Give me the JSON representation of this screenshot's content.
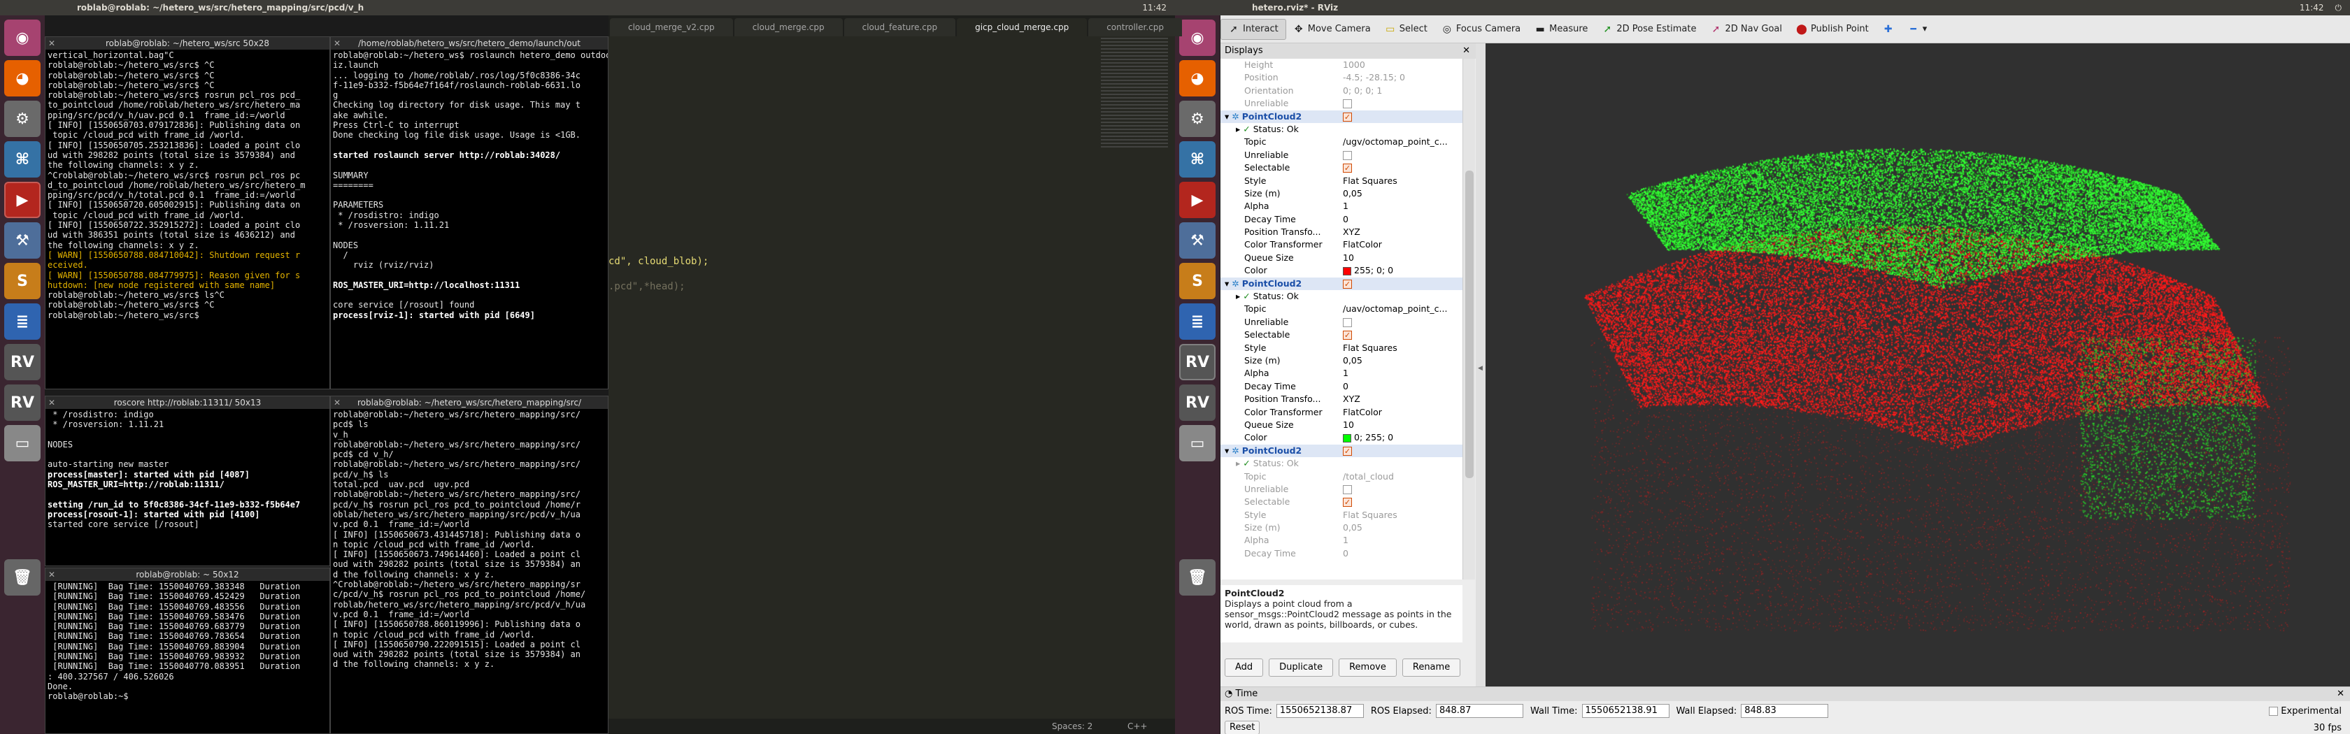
{
  "topbar_left": {
    "title": "roblab@roblab: ~/hetero_ws/src/hetero_mapping/src/pcd/v_h",
    "time": "11:42"
  },
  "topbar_right": {
    "title": "hetero.rviz* - RViz",
    "time": "11:42"
  },
  "launcher": {
    "items": [
      "dash-icon",
      "firefox-icon",
      "settings-icon",
      "python-icon",
      "terminal-icon",
      "system-settings-icon",
      "sublime-icon",
      "document-icon",
      "rviz-icon",
      "rviz-icon",
      "drive-icon",
      "trash-icon"
    ]
  },
  "terminals": {
    "t1": {
      "title": "roblab@roblab: ~/hetero_ws/src 50x28",
      "lines": [
        "vertical_horizontal.bag\"C",
        "roblab@roblab:~/hetero_ws/src$ ^C",
        "roblab@roblab:~/hetero_ws/src$ ^C",
        "roblab@roblab:~/hetero_ws/src$ ^C",
        "roblab@roblab:~/hetero_ws/src$ rosrun pcl_ros pcd_",
        "to_pointcloud /home/roblab/hetero_ws/src/hetero_ma",
        "pping/src/pcd/v_h/uav.pcd 0.1  frame_id:=/world",
        "[ INFO] [1550650703.079172836]: Publishing data on",
        " topic /cloud_pcd with frame_id /world.",
        "[ INFO] [1550650705.253213836]: Loaded a point clo",
        "ud with 298282 points (total size is 3579384) and",
        "the following channels: x y z.",
        "^Croblab@roblab:~/hetero_ws/src$ rosrun pcl_ros pc",
        "d_to_pointcloud /home/roblab/hetero_ws/src/hetero_m",
        "pping/src/pcd/v_h/total.pcd 0.1  frame_id:=/world",
        "[ INFO] [1550650720.605002915]: Publishing data on",
        " topic /cloud_pcd with frame_id /world.",
        "[ INFO] [1550650722.352915272]: Loaded a point clo",
        "ud with 386351 points (total size is 4636212) and",
        "the following channels: x y z.",
        "[ WARN] [1550650788.084710042]: Shutdown request r",
        "eceived.",
        "[ WARN] [1550650788.084779975]: Reason given for s",
        "hutdown: [new node registered with same name]",
        "roblab@roblab:~/hetero_ws/src$ ls^C",
        "roblab@roblab:~/hetero_ws/src$ ^C",
        "roblab@roblab:~/hetero_ws/src$ "
      ]
    },
    "t2": {
      "title": "/home/roblab/hetero_ws/src/hetero_demo/launch/out",
      "lines": [
        "roblab@roblab:~/hetero_ws$ roslaunch hetero_demo outdoor_rv",
        "iz.launch",
        "... logging to /home/roblab/.ros/log/5f0c8386-34c",
        "f-11e9-b332-f5b64e7f164f/roslaunch-roblab-6631.lo",
        "g",
        "Checking log directory for disk usage. This may t",
        "ake awhile.",
        "Press Ctrl-C to interrupt",
        "Done checking log file disk usage. Usage is <1GB.",
        "",
        "started roslaunch server http://roblab:34028/",
        "",
        "SUMMARY",
        "========",
        "",
        "PARAMETERS",
        " * /rosdistro: indigo",
        " * /rosversion: 1.11.21",
        "",
        "NODES",
        "  /",
        "    rviz (rviz/rviz)",
        "",
        "ROS_MASTER_URI=http://localhost:11311",
        "",
        "core service [/rosout] found",
        "process[rviz-1]: started with pid [6649]"
      ]
    },
    "t3": {
      "title": "roscore http://roblab:11311/ 50x13",
      "lines": [
        " * /rosdistro: indigo",
        " * /rosversion: 1.11.21",
        "",
        "NODES",
        "",
        "auto-starting new master",
        "process[master]: started with pid [4087]",
        "ROS_MASTER_URI=http://roblab:11311/",
        "",
        "setting /run_id to 5f0c8386-34cf-11e9-b332-f5b64e7",
        "process[rosout-1]: started with pid [4100]",
        "started core service [/rosout]"
      ]
    },
    "t4": {
      "title": "roblab@roblab: ~/hetero_ws/src/hetero_mapping/src/",
      "lines": [
        "roblab@roblab:~/hetero_ws/src/hetero_mapping/src/",
        "pcd$ ls",
        "v_h",
        "roblab@roblab:~/hetero_ws/src/hetero_mapping/src/",
        "pcd$ cd v_h/",
        "roblab@roblab:~/hetero_ws/src/hetero_mapping/src/",
        "pcd/v_h$ ls",
        "total.pcd  uav.pcd  ugv.pcd",
        "roblab@roblab:~/hetero_ws/src/hetero_mapping/src/",
        "pcd/v_h$ rosrun pcl_ros pcd_to_pointcloud /home/r",
        "oblab/hetero_ws/src/hetero_mapping/src/pcd/v_h/ua",
        "v.pcd 0.1  frame_id:=/world",
        "[ INFO] [1550650673.431445718]: Publishing data o",
        "n topic /cloud_pcd with frame_id /world.",
        "[ INFO] [1550650673.749614460]: Loaded a point cl",
        "oud with 298282 points (total size is 3579384) an",
        "d the following channels: x y z.",
        "^Croblab@roblab:~/hetero_ws/src/hetero_mapping/sr",
        "c/pcd/v_h$ rosrun pcl_ros pcd_to_pointcloud /home/",
        "roblab/hetero_ws/src/hetero_mapping/src/pcd/v_h/ua",
        "v.pcd 0.1  frame_id:=/world",
        "[ INFO] [1550650788.860119996]: Publishing data o",
        "n topic /cloud_pcd with frame_id /world.",
        "[ INFO] [1550650790.222091515]: Loaded a point cl",
        "oud with 298282 points (total size is 3579384) an",
        "d the following channels: x y z."
      ]
    },
    "t5": {
      "title": "roblab@roblab: ~ 50x12",
      "lines": [
        " [RUNNING]  Bag Time: 1550040769.383348   Duration",
        " [RUNNING]  Bag Time: 1550040769.452429   Duration",
        " [RUNNING]  Bag Time: 1550040769.483556   Duration",
        " [RUNNING]  Bag Time: 1550040769.583476   Duration",
        " [RUNNING]  Bag Time: 1550040769.683779   Duration",
        " [RUNNING]  Bag Time: 1550040769.783654   Duration",
        " [RUNNING]  Bag Time: 1550040769.883904   Duration",
        " [RUNNING]  Bag Time: 1550040769.983932   Duration",
        " [RUNNING]  Bag Time: 1550040770.083951   Duration",
        ": 400.327567 / 406.526026",
        "Done.",
        "roblab@roblab:~$ "
      ]
    }
  },
  "editor": {
    "tabs": [
      "cloud_merge_v2.cpp",
      "cloud_merge.cpp",
      "cloud_feature.cpp",
      "gicp_cloud_merge.cpp",
      "controller.cpp"
    ],
    "code1": "cd\", cloud_blob);",
    "code2": ".pcd\",*head);",
    "status_spaces": "Spaces: 2",
    "status_lang": "C++"
  },
  "rviz": {
    "toolbar": [
      "Interact",
      "Move Camera",
      "Select",
      "Focus Camera",
      "Measure",
      "2D Pose Estimate",
      "2D Nav Goal",
      "Publish Point"
    ],
    "displays_title": "Displays",
    "rows": [
      {
        "k": "Height",
        "v": "1000",
        "g": true
      },
      {
        "k": "Position",
        "v": "-4.5; -28.15; 0",
        "g": true
      },
      {
        "k": "Orientation",
        "v": "0; 0; 0; 1",
        "g": true
      },
      {
        "k": "Unreliable",
        "v": "",
        "g": true
      },
      {
        "k": "PointCloud2",
        "v": "",
        "h": true
      },
      {
        "k": "Status: Ok",
        "v": ""
      },
      {
        "k": "Topic",
        "v": "/ugv/octomap_point_c..."
      },
      {
        "k": "Unreliable",
        "v": ""
      },
      {
        "k": "Selectable",
        "v": ""
      },
      {
        "k": "Style",
        "v": "Flat Squares"
      },
      {
        "k": "Size (m)",
        "v": "0,05"
      },
      {
        "k": "Alpha",
        "v": "1"
      },
      {
        "k": "Decay Time",
        "v": "0"
      },
      {
        "k": "Position Transfo...",
        "v": "XYZ"
      },
      {
        "k": "Color Transformer",
        "v": "FlatColor"
      },
      {
        "k": "Queue Size",
        "v": "10"
      },
      {
        "k": "Color",
        "v": "255; 0; 0"
      },
      {
        "k": "PointCloud2",
        "v": "",
        "h": true
      },
      {
        "k": "Status: Ok",
        "v": ""
      },
      {
        "k": "Topic",
        "v": "/uav/octomap_point_c..."
      },
      {
        "k": "Unreliable",
        "v": ""
      },
      {
        "k": "Selectable",
        "v": ""
      },
      {
        "k": "Style",
        "v": "Flat Squares"
      },
      {
        "k": "Size (m)",
        "v": "0,05"
      },
      {
        "k": "Alpha",
        "v": "1"
      },
      {
        "k": "Decay Time",
        "v": "0"
      },
      {
        "k": "Position Transfo...",
        "v": "XYZ"
      },
      {
        "k": "Color Transformer",
        "v": "FlatColor"
      },
      {
        "k": "Queue Size",
        "v": "10"
      },
      {
        "k": "Color",
        "v": "0; 255; 0"
      },
      {
        "k": "PointCloud2",
        "v": "",
        "h": true
      },
      {
        "k": "Status: Ok",
        "v": "",
        "g": true
      },
      {
        "k": "Topic",
        "v": "/total_cloud",
        "g": true
      },
      {
        "k": "Unreliable",
        "v": "",
        "g": true
      },
      {
        "k": "Selectable",
        "v": "",
        "g": true
      },
      {
        "k": "Style",
        "v": "Flat Squares",
        "g": true
      },
      {
        "k": "Size (m)",
        "v": "0,05",
        "g": true
      },
      {
        "k": "Alpha",
        "v": "1",
        "g": true
      },
      {
        "k": "Decay Time",
        "v": "0",
        "g": true
      }
    ],
    "desc_title": "PointCloud2",
    "desc_text": "Displays a point cloud from a sensor_msgs::PointCloud2 message as points in the world, drawn as points, billboards, or cubes.",
    "buttons": [
      "Add",
      "Duplicate",
      "Remove",
      "Rename"
    ],
    "time_title": "Time",
    "ros_time_label": "ROS Time:",
    "ros_time": "1550652138.87",
    "ros_elapsed_label": "ROS Elapsed:",
    "ros_elapsed": "848.87",
    "wall_time_label": "Wall Time:",
    "wall_time": "1550652138.91",
    "wall_elapsed_label": "Wall Elapsed:",
    "wall_elapsed": "848.83",
    "experimental": "Experimental",
    "reset": "Reset",
    "fps": "30 fps",
    "color_red": "#ff0000",
    "color_green": "#00ff00"
  }
}
